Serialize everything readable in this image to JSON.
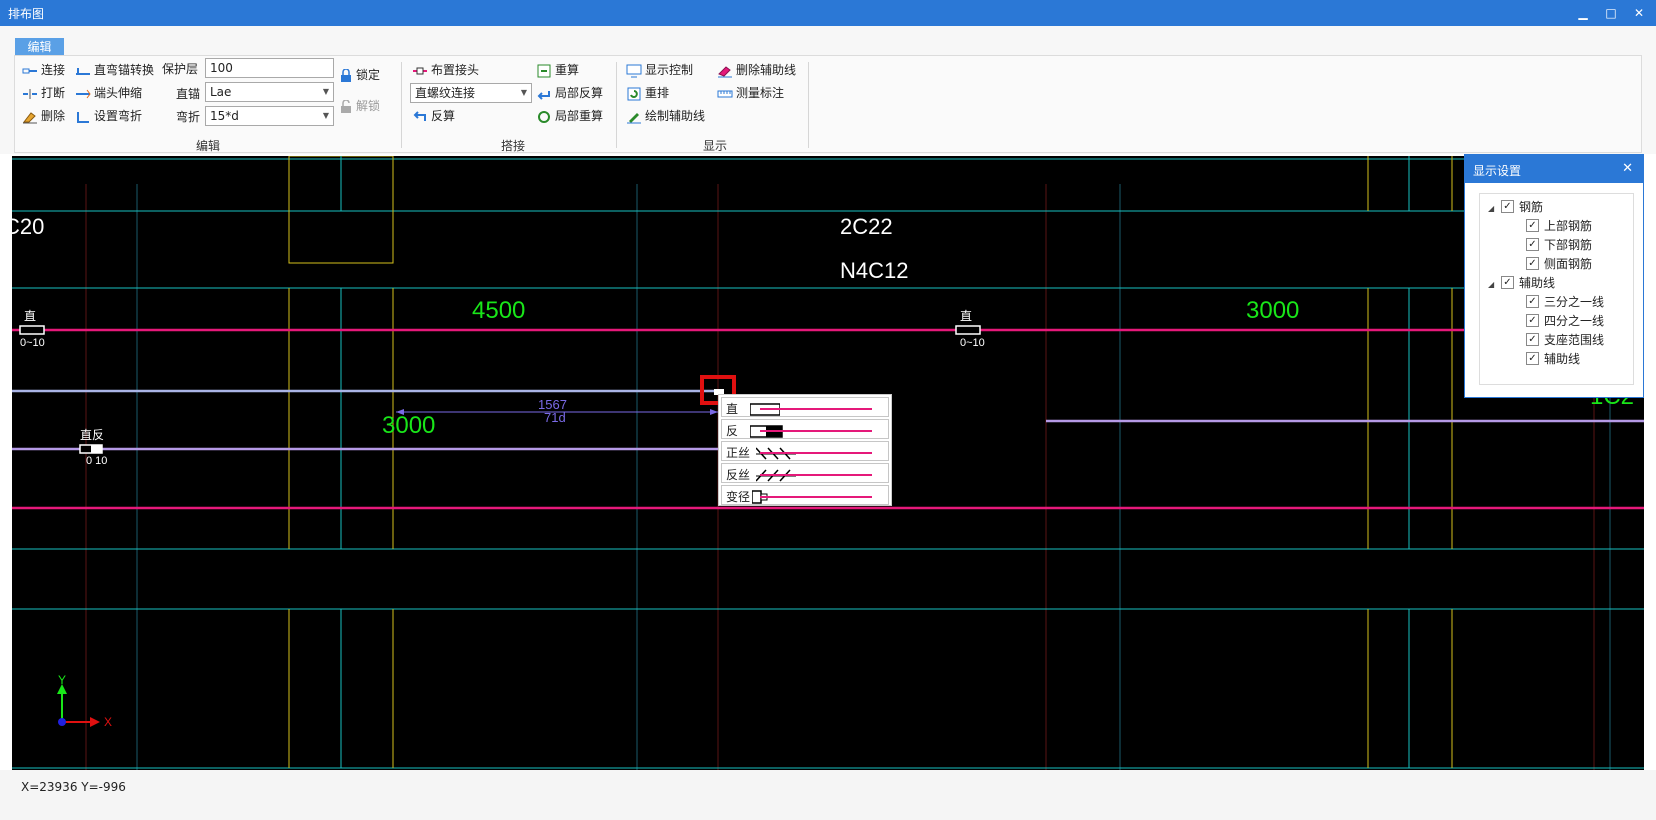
{
  "window": {
    "title": "排布图",
    "min": "▁",
    "max": "□",
    "close": "✕"
  },
  "ribbon": {
    "tab": "编辑",
    "edit": {
      "connect": "连接",
      "break": "打断",
      "delete": "删除",
      "straight_bend_convert": "直弯锚转换",
      "end_extend": "端头伸缩",
      "set_bend": "设置弯折",
      "cover_label": "保护层",
      "cover_value": "100",
      "anchor_label": "直锚",
      "anchor_value": "Lae",
      "bend_label": "弯折",
      "bend_value": "15*d",
      "lock": "锁定",
      "unlock": "解锁",
      "group": "编辑"
    },
    "splice": {
      "place_joint": "布置接头",
      "splice_type": "直螺纹连接",
      "reverse_calc": "反算",
      "recalc": "重算",
      "local_reverse": "局部反算",
      "local_recalc": "局部重算",
      "group": "搭接"
    },
    "display": {
      "display_control": "显示控制",
      "rearrange": "重排",
      "draw_aux": "绘制辅助线",
      "delete_aux": "删除辅助线",
      "measure": "测量标注",
      "group": "显示"
    }
  },
  "drawing": {
    "labels": {
      "c20": "C20",
      "c22": "2C22",
      "n4c12": "N4C12",
      "d4500": "4500",
      "d3000a": "3000",
      "d3000b": "3000",
      "d1c2": "1C2",
      "zhi1": "直",
      "range1": "0~10",
      "zhi2": "直",
      "range2": "0~10",
      "zhifan": "直反",
      "range3": "0  10",
      "dim_len": "1567",
      "dim_d": "71d",
      "axis_y": "Y",
      "axis_x": "X"
    },
    "colors": {
      "magenta": "#e5197a",
      "cyan": "#19c0c0",
      "yellow": "#d4c01c",
      "green": "#19e619",
      "lilac": "#b59ae6",
      "red": "#8b1a1a"
    }
  },
  "joint_menu": {
    "items": [
      {
        "label": "直",
        "icon": "straight-joint-icon"
      },
      {
        "label": "反",
        "icon": "reverse-joint-icon"
      },
      {
        "label": "正丝",
        "icon": "forward-thread-icon"
      },
      {
        "label": "反丝",
        "icon": "reverse-thread-icon"
      },
      {
        "label": "变径",
        "icon": "reducer-joint-icon"
      }
    ]
  },
  "display_settings": {
    "title": "显示设置",
    "close": "✕",
    "tree": {
      "rebar": "钢筋",
      "top": "上部钢筋",
      "bottom": "下部钢筋",
      "side": "侧面钢筋",
      "aux": "辅助线",
      "third": "三分之一线",
      "quarter": "四分之一线",
      "support": "支座范围线",
      "auxline": "辅助线"
    }
  },
  "status": {
    "coords": "X=23936 Y=-996"
  }
}
